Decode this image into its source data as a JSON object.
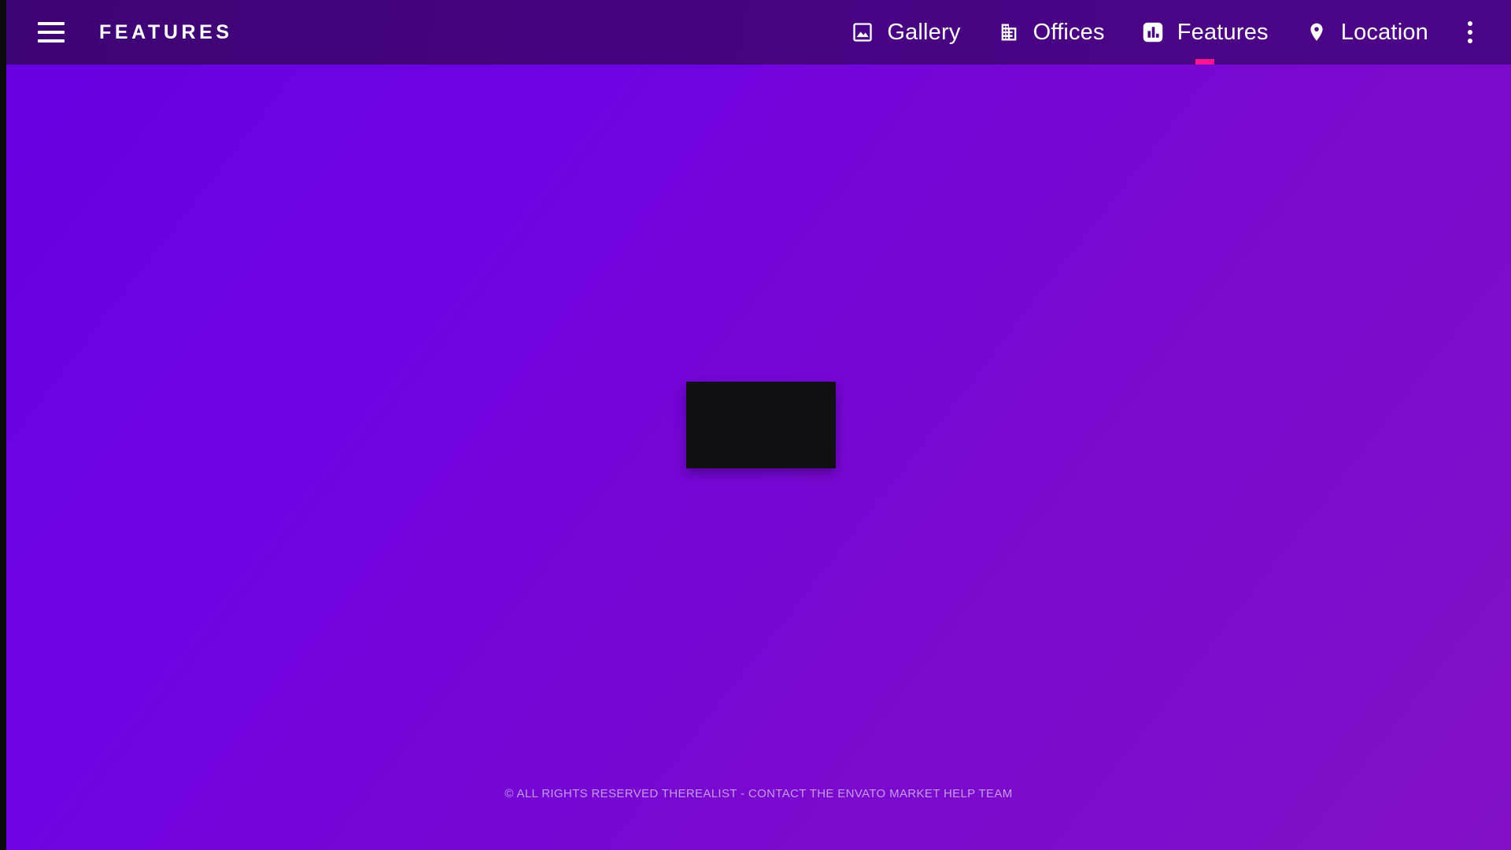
{
  "theme": {
    "appbar_gradient_start": "#3d0473",
    "appbar_gradient_end": "#4d0587",
    "body_gradient_start": "#6600e0",
    "body_gradient_end": "#8310c6",
    "accent": "#ff1493",
    "text_on_dark": "#ffffff",
    "footer_text_color": "#c49cf0",
    "placeholder_color": "#111015",
    "gutter_color": "#0b0b0f"
  },
  "appbar": {
    "menu_icon": "hamburger-menu-icon",
    "brand": "FEATURES",
    "overflow_icon": "more-vertical-icon",
    "tabs": [
      {
        "label": "Gallery",
        "icon": "image-icon",
        "active": false
      },
      {
        "label": "Offices",
        "icon": "building-icon",
        "active": false
      },
      {
        "label": "Features",
        "icon": "bar-chart-icon",
        "active": true
      },
      {
        "label": "Location",
        "icon": "map-pin-icon",
        "active": false
      }
    ]
  },
  "main": {
    "media_placeholder_label": "media-placeholder"
  },
  "footer": {
    "text": "© ALL RIGHTS RESERVED THEREALIST  - CONTACT THE ENVATO MARKET HELP TEAM"
  }
}
